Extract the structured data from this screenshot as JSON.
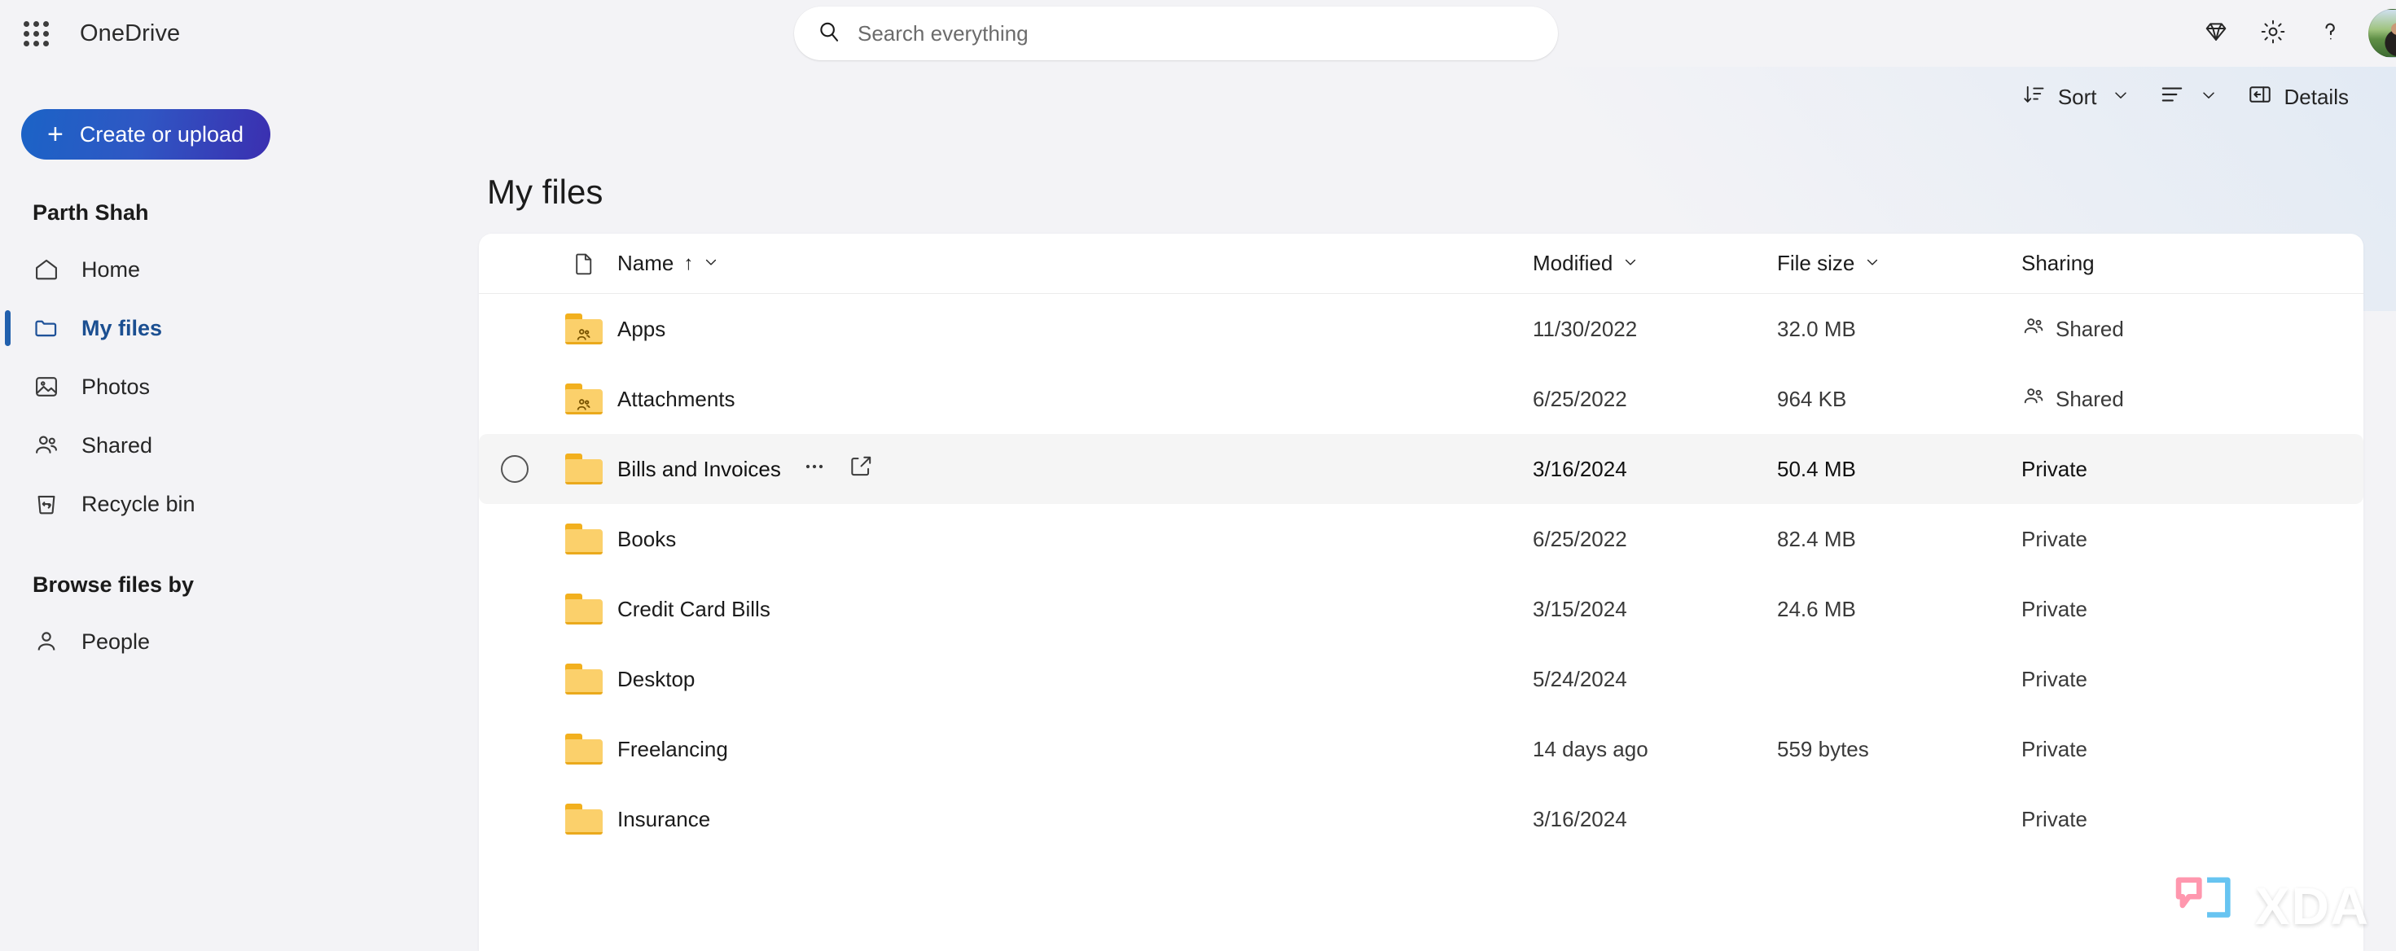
{
  "app": {
    "brand": "OneDrive",
    "waffle_icon": "app-launcher-grid-icon"
  },
  "search": {
    "placeholder": "Search everything",
    "value": "",
    "icon": "search-icon"
  },
  "topbar_actions": [
    {
      "name": "premium-diamond-icon",
      "label": ""
    },
    {
      "name": "settings-gear-icon",
      "label": ""
    },
    {
      "name": "help-question-icon",
      "label": ""
    }
  ],
  "account": {
    "avatar_label": "Parth Shah"
  },
  "sidebar": {
    "create_button": "Create or upload",
    "create_plus": "+",
    "user_name": "Parth Shah",
    "items": [
      {
        "label": "Home",
        "icon": "home-icon",
        "selected": false
      },
      {
        "label": "My files",
        "icon": "folder-icon",
        "selected": true
      },
      {
        "label": "Photos",
        "icon": "photo-icon",
        "selected": false
      },
      {
        "label": "Shared",
        "icon": "people-icon",
        "selected": false
      },
      {
        "label": "Recycle bin",
        "icon": "recycle-bin-icon",
        "selected": false
      }
    ],
    "group_title": "Browse files by",
    "browse_items": [
      {
        "label": "People",
        "icon": "person-icon",
        "selected": false
      }
    ]
  },
  "toolbar": {
    "sort_label": "Sort",
    "sort_icon": "sort-descending-icon",
    "view_icon": "list-view-icon",
    "details_label": "Details",
    "details_icon": "details-pane-icon"
  },
  "main": {
    "page_title": "My files"
  },
  "table": {
    "columns": {
      "icon": "file-type-icon",
      "name": "Name",
      "name_sort": "↑",
      "modified": "Modified",
      "file_size": "File size",
      "sharing": "Sharing"
    },
    "row_actions": {
      "more_label": "···",
      "more_icon": "more-options-icon",
      "share_icon": "share-icon",
      "select_icon": "selection-circle-icon"
    },
    "rows": [
      {
        "name": "Apps",
        "modified": "11/30/2022",
        "size": "32.0 MB",
        "sharing": "Shared",
        "shared": true,
        "hovered": false
      },
      {
        "name": "Attachments",
        "modified": "6/25/2022",
        "size": "964 KB",
        "sharing": "Shared",
        "shared": true,
        "hovered": false
      },
      {
        "name": "Bills and Invoices",
        "modified": "3/16/2024",
        "size": "50.4 MB",
        "sharing": "Private",
        "shared": false,
        "hovered": true
      },
      {
        "name": "Books",
        "modified": "6/25/2022",
        "size": "82.4 MB",
        "sharing": "Private",
        "shared": false,
        "hovered": false
      },
      {
        "name": "Credit Card Bills",
        "modified": "3/15/2024",
        "size": "24.6 MB",
        "sharing": "Private",
        "shared": false,
        "hovered": false
      },
      {
        "name": "Desktop",
        "modified": "5/24/2024",
        "size": "",
        "sharing": "Private",
        "shared": false,
        "hovered": false
      },
      {
        "name": "Freelancing",
        "modified": "14 days ago",
        "size": "559 bytes",
        "sharing": "Private",
        "shared": false,
        "hovered": false
      },
      {
        "name": "Insurance",
        "modified": "3/16/2024",
        "size": "",
        "sharing": "Private",
        "shared": false,
        "hovered": false
      }
    ]
  },
  "watermark": {
    "text": "XDA",
    "logo": "xda-speech-bubble-logo"
  },
  "colors": {
    "accent_blue": "#2160ad",
    "create_gradient_start": "#1b63c6",
    "create_gradient_end": "#3b2fb0",
    "folder_yellow": "#fbd06b",
    "page_bg": "#f3f3f6",
    "card_bg": "#ffffff",
    "hover_row": "#f5f5f5",
    "watermark_pink": "#ff8fa8",
    "watermark_blue": "#5bc0f0"
  }
}
